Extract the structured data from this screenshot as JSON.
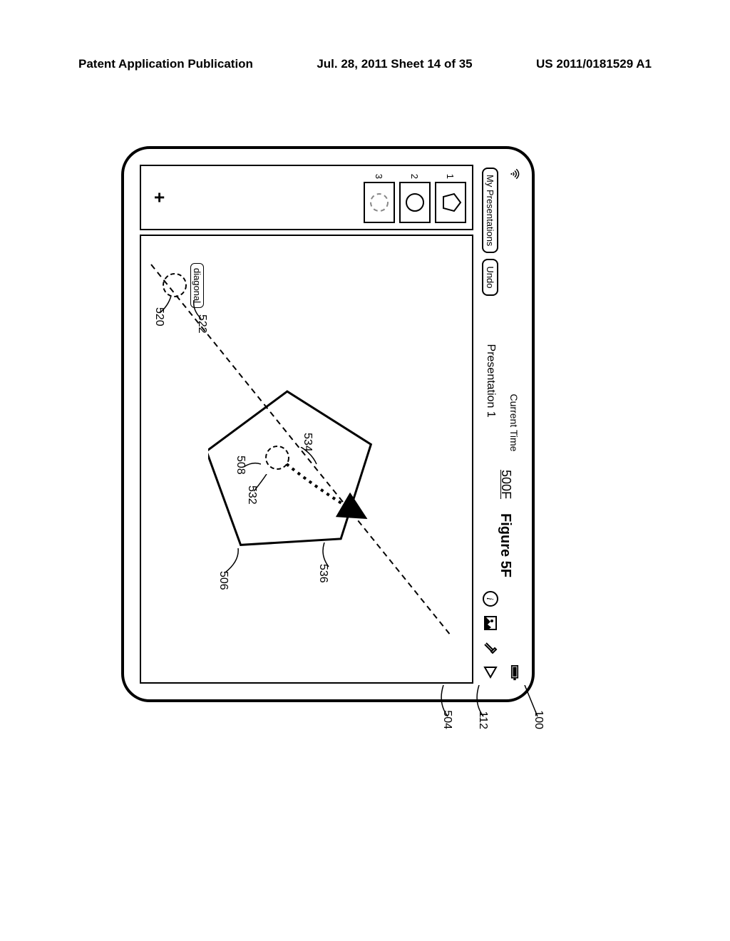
{
  "header": {
    "left": "Patent Application Publication",
    "center": "Jul. 28, 2011  Sheet 14 of 35",
    "right": "US 2011/0181529 A1"
  },
  "device": {
    "statusbar": {
      "time_label": "Current Time"
    },
    "toolbar": {
      "my_presentations": "My Presentations",
      "undo": "Undo",
      "title": "Presentation 1"
    },
    "thumbs": [
      {
        "num": "1"
      },
      {
        "num": "2"
      },
      {
        "num": "3"
      }
    ],
    "add_slide": "+",
    "diagonal_label": "diagonal"
  },
  "refs": {
    "r100": "100",
    "r112": "112",
    "r504": "504",
    "r536": "536",
    "r506": "506",
    "r534": "534",
    "r532": "532",
    "r508": "508",
    "r522": "522",
    "r520": "520"
  },
  "figure": {
    "caption": "Figure 5F",
    "id": "500F"
  }
}
